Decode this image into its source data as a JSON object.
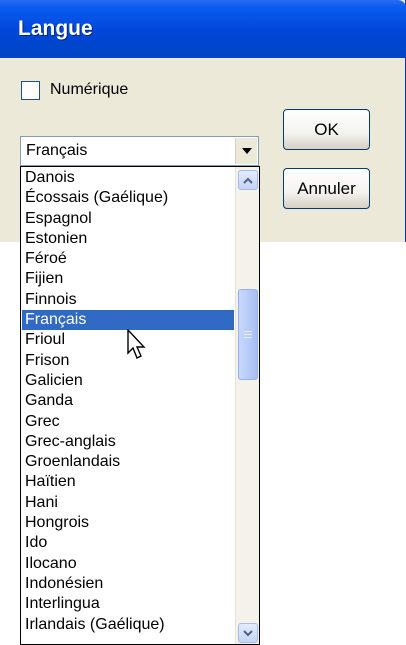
{
  "window": {
    "title": "Langue"
  },
  "checkbox": {
    "label": "Numérique",
    "checked": false
  },
  "buttons": {
    "ok_label": "OK",
    "cancel_label": "Annuler"
  },
  "combo": {
    "selected_value": "Français"
  },
  "dropdown": {
    "items": [
      "Danois",
      "Écossais (Gaélique)",
      "Espagnol",
      "Estonien",
      "Féroé",
      "Fijien",
      "Finnois",
      "Français",
      "Frioul",
      "Frison",
      "Galicien",
      "Ganda",
      "Grec",
      "Grec-anglais",
      "Groenlandais",
      "Haïtien",
      "Hani",
      "Hongrois",
      "Ido",
      "Ilocano",
      "Indonésien",
      "Interlingua",
      "Irlandais (Gaélique)"
    ],
    "selected_index": 7
  },
  "colors": {
    "titlebar": "#0046d8",
    "selection": "#316ac5",
    "dialog_bg": "#ece9d8"
  },
  "icons": {
    "combo_arrow": "chevron-down-icon",
    "scroll_up": "arrow-up-icon",
    "scroll_down": "arrow-down-icon",
    "cursor": "mouse-pointer-icon"
  }
}
